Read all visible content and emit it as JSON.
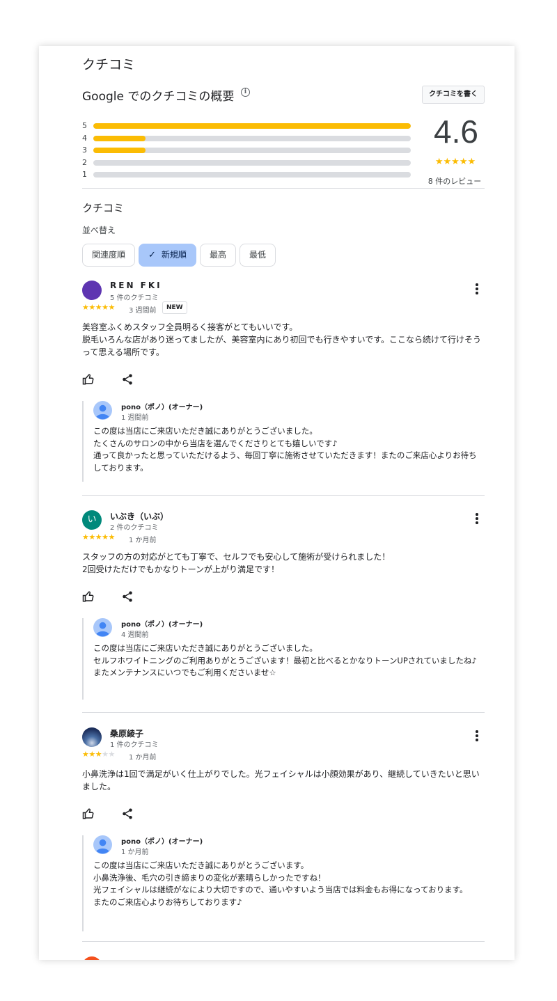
{
  "page_title": "クチコミ",
  "summary": {
    "title": "Google でのクチコミの概要",
    "info_icon": "info-icon",
    "write_button": "クチコミを書く",
    "histogram": [
      {
        "label": "5",
        "fraction": 1.0
      },
      {
        "label": "4",
        "fraction": 0.165
      },
      {
        "label": "3",
        "fraction": 0.165
      },
      {
        "label": "2",
        "fraction": 0.0
      },
      {
        "label": "1",
        "fraction": 0.0
      }
    ],
    "rating": "4.6",
    "rating_stars": "★★★★★",
    "total_reviews": "8 件のレビュー"
  },
  "reviews_section": {
    "title": "クチコミ",
    "sort_label": "並べ替え",
    "chips": [
      {
        "label": "関連度順",
        "selected": false
      },
      {
        "label": "新規順",
        "selected": true
      },
      {
        "label": "最高",
        "selected": false
      },
      {
        "label": "最低",
        "selected": false
      }
    ]
  },
  "colors": {
    "star": "#fbbc04",
    "chip_selected": "#a8c7fa",
    "avatar_purple": "#5e35b1",
    "avatar_teal": "#00897b"
  },
  "reviews": [
    {
      "name": "REN FKI",
      "count": "5 件のクチコミ",
      "stars": "★★★★★",
      "stars_gray": "",
      "time": "3 週間前",
      "badge": "NEW",
      "text": "美容室ふくめスタッフ全員明るく接客がとてもいいです。\n脱毛いろんな店があり迷ってましたが、美容室内にあり初回でも行きやすいです。ここなら続けて行けそうって思える場所です。",
      "reply": {
        "name": "pono（ポノ）(オーナー)",
        "time": "1 週間前",
        "text": "この度は当店にご来店いただき誠にありがとうございました。\nたくさんのサロンの中から当店を選んでくださりとても嬉しいです♪\n通って良かったと思っていただけるよう、毎回丁寧に施術させていただきます！またのご来店心よりお待ちしております。"
      }
    },
    {
      "name": "いぶき（いぶ）",
      "avatar_letter": "い",
      "count": "2 件のクチコミ",
      "stars": "★★★★★",
      "stars_gray": "",
      "time": "1 か月前",
      "text": "スタッフの方の対応がとても丁寧で、セルフでも安心して施術が受けられました！\n2回受けただけでもかなりトーンが上がり満足です！",
      "reply": {
        "name": "pono（ポノ）(オーナー)",
        "time": "4 週間前",
        "text": "この度は当店にご来店いただき誠にありがとうございました。\nセルフホワイトニングのご利用ありがとうございます！最初と比べるとかなりトーンUPされていましたね♪\nまたメンテナンスにいつでもご利用くださいませ☆"
      }
    },
    {
      "name": "桑原綾子",
      "count": "1 件のクチコミ",
      "stars": "★★★",
      "stars_gray": "★★",
      "time": "1 か月前",
      "text": "小鼻洗浄は1回で満足がいく仕上がりでした。光フェイシャルは小顔効果があり、継続していきたいと思いました。",
      "reply": {
        "name": "pono（ポノ）(オーナー)",
        "time": "1 か月前",
        "text": "この度は当店にご来店いただき誠にありがとうございます。\n小鼻洗浄後、毛穴の引き締まりの変化が素晴らしかったですね！\n光フェイシャルは継続がなにより大切ですので、通いやすいよう当店では料金もお得になっております。\nまたのご来店心よりお待ちしております♪"
      }
    }
  ]
}
